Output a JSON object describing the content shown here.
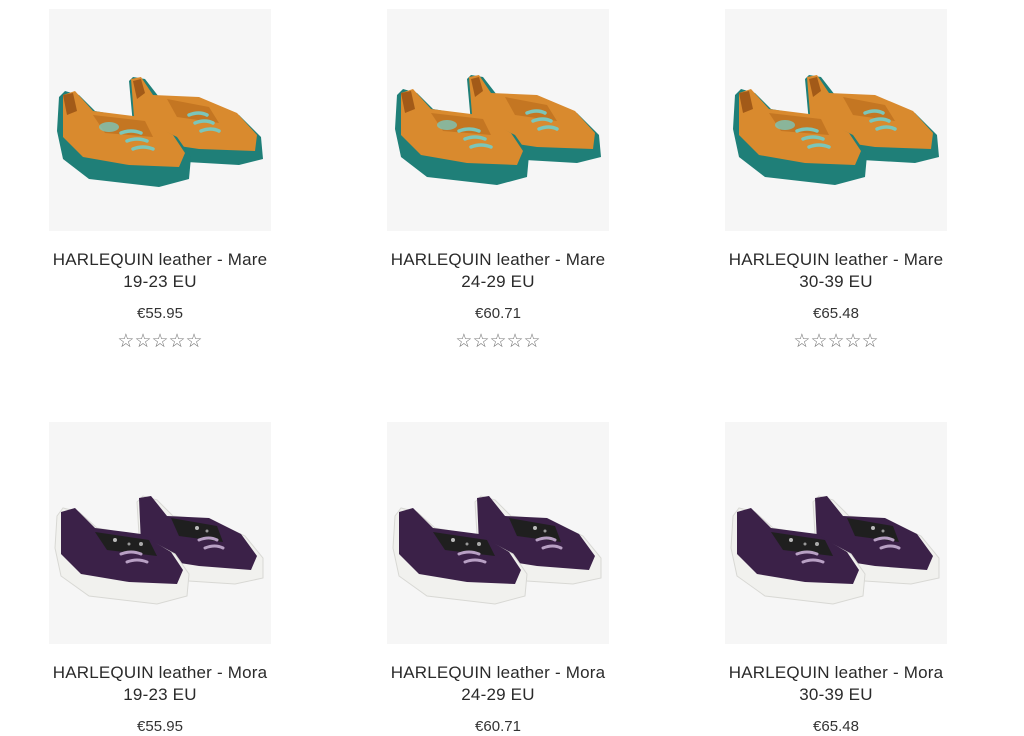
{
  "colors": {
    "mare_upper": "#d98a2e",
    "mare_sole": "#1f7f78",
    "mare_lace": "#7cc6b9",
    "mora_upper": "#3b2148",
    "mora_sole": "#f1f1ee",
    "mora_strap": "#1f1f1f"
  },
  "rating_icon": "star-outline",
  "products": [
    {
      "name_line1": "HARLEQUIN leather - Mare",
      "name_line2": "19-23 EU",
      "price": "€55.95",
      "rating": "☆☆☆☆☆",
      "variant": "mare"
    },
    {
      "name_line1": "HARLEQUIN leather - Mare",
      "name_line2": "24-29 EU",
      "price": "€60.71",
      "rating": "☆☆☆☆☆",
      "variant": "mare"
    },
    {
      "name_line1": "HARLEQUIN leather - Mare",
      "name_line2": "30-39 EU",
      "price": "€65.48",
      "rating": "☆☆☆☆☆",
      "variant": "mare"
    },
    {
      "name_line1": "HARLEQUIN leather - Mora",
      "name_line2": "19-23 EU",
      "price": "€55.95",
      "variant": "mora"
    },
    {
      "name_line1": "HARLEQUIN leather - Mora",
      "name_line2": "24-29 EU",
      "price": "€60.71",
      "variant": "mora"
    },
    {
      "name_line1": "HARLEQUIN leather - Mora",
      "name_line2": "30-39 EU",
      "price": "€65.48",
      "variant": "mora"
    }
  ]
}
